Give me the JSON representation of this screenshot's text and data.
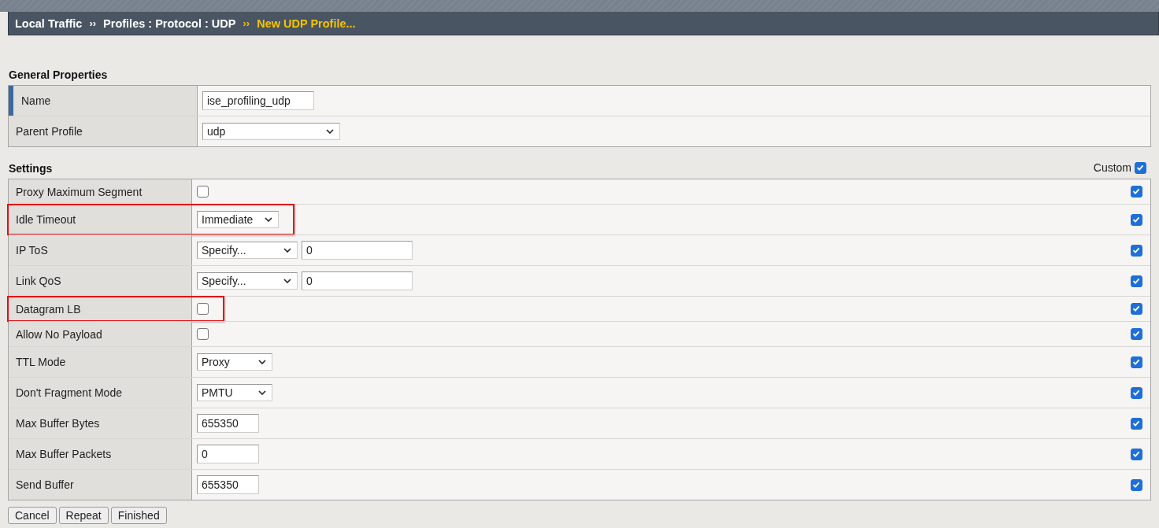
{
  "breadcrumb": [
    {
      "label": "Local Traffic",
      "current": false
    },
    {
      "separator": "››",
      "label": "Profiles : Protocol : UDP",
      "current": false
    },
    {
      "separator": "››",
      "label": "New UDP Profile...",
      "current": true
    }
  ],
  "general": {
    "title": "General Properties",
    "rows": [
      {
        "label": "Name",
        "kind": "text",
        "value": "ise_profiling_udp",
        "marked": true
      },
      {
        "label": "Parent Profile",
        "kind": "select",
        "value": "udp",
        "marked": false
      }
    ]
  },
  "settings": {
    "title": "Settings",
    "custom_label": "Custom",
    "custom_checked": true,
    "rows": [
      {
        "label": "Proxy Maximum Segment",
        "kind": "checkbox",
        "checked": false,
        "custom": true,
        "highlighted": false
      },
      {
        "label": "Idle Timeout",
        "kind": "select",
        "value": "Immediate",
        "custom": true,
        "highlighted": true
      },
      {
        "label": "IP ToS",
        "kind": "select_text",
        "value": "Specify...",
        "text": "0",
        "custom": true,
        "highlighted": false
      },
      {
        "label": "Link QoS",
        "kind": "select_text",
        "value": "Specify...",
        "text": "0",
        "custom": true,
        "highlighted": false
      },
      {
        "label": "Datagram LB",
        "kind": "checkbox",
        "checked": false,
        "custom": true,
        "highlighted": true
      },
      {
        "label": "Allow No Payload",
        "kind": "checkbox",
        "checked": false,
        "custom": true,
        "highlighted": false
      },
      {
        "label": "TTL Mode",
        "kind": "select",
        "value": "Proxy",
        "custom": true,
        "highlighted": false
      },
      {
        "label": "Don't Fragment Mode",
        "kind": "select",
        "value": "PMTU",
        "custom": true,
        "highlighted": false
      },
      {
        "label": "Max Buffer Bytes",
        "kind": "text",
        "value": "655350",
        "custom": true,
        "highlighted": false
      },
      {
        "label": "Max Buffer Packets",
        "kind": "text",
        "value": "0",
        "custom": true,
        "highlighted": false
      },
      {
        "label": "Send Buffer",
        "kind": "text",
        "value": "655350",
        "custom": true,
        "highlighted": false
      }
    ]
  },
  "buttons": [
    "Cancel",
    "Repeat",
    "Finished"
  ]
}
